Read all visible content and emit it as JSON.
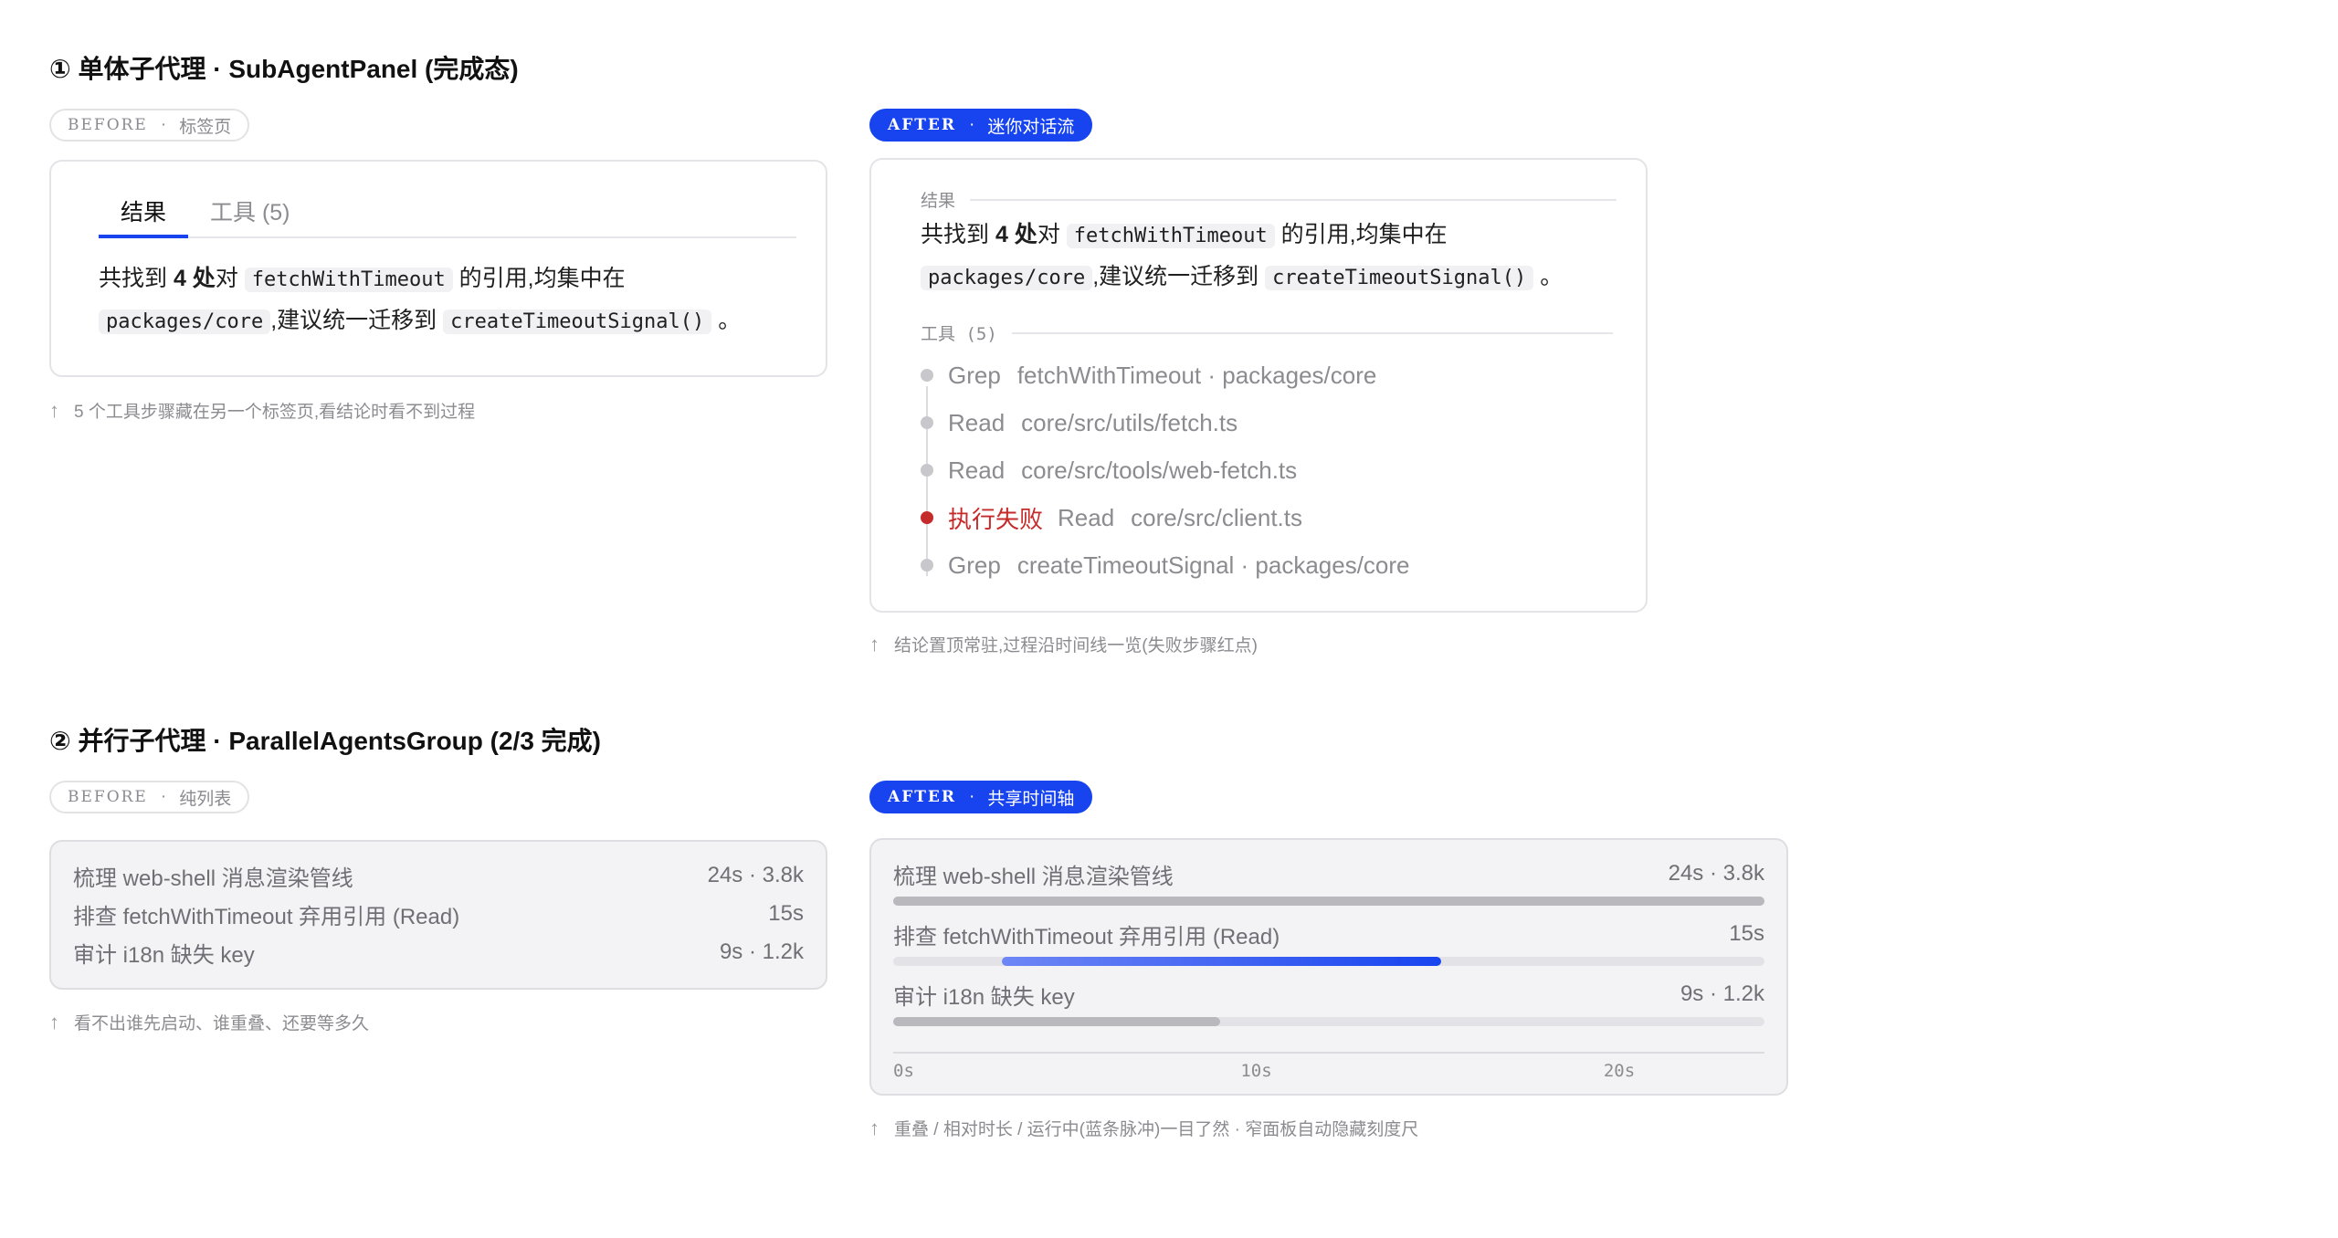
{
  "section1": {
    "title": "① 单体子代理 · SubAgentPanel (完成态)",
    "before": {
      "tag": "BEFORE",
      "sep": "·",
      "label": "标签页",
      "tabs": [
        {
          "label": "结果"
        },
        {
          "label": "工具 (5)"
        }
      ],
      "text": {
        "p1": "共找到 ",
        "count": "4 处",
        "p2": "对 ",
        "code1": "fetchWithTimeout",
        "p3": " 的引用,均集中在",
        "code2": "packages/core",
        "p4": ",建议统一迁移到 ",
        "code3": "createTimeoutSignal()",
        "p5": " 。"
      },
      "note": "5 个工具步骤藏在另一个标签页,看结论时看不到过程"
    },
    "after": {
      "tag": "AFTER",
      "sep": "·",
      "label": "迷你对话流",
      "result_head": "结果",
      "text": {
        "p1": "共找到 ",
        "count": "4 处",
        "p2": "对 ",
        "code1": "fetchWithTimeout",
        "p3": " 的引用,均集中在",
        "code2": "packages/core",
        "p4": ",建议统一迁移到 ",
        "code3": "createTimeoutSignal()",
        "p5": " 。"
      },
      "tools_head": "工具 (5)",
      "steps": [
        {
          "status": "done",
          "tool": "Grep",
          "target": "fetchWithTimeout · packages/core"
        },
        {
          "status": "done",
          "tool": "Read",
          "target": "core/src/utils/fetch.ts"
        },
        {
          "status": "done",
          "tool": "Read",
          "target": "core/src/tools/web-fetch.ts"
        },
        {
          "status": "failed",
          "fail_label": "执行失败",
          "tool": "Read",
          "target": "core/src/client.ts"
        },
        {
          "status": "done",
          "tool": "Grep",
          "target": "createTimeoutSignal · packages/core"
        }
      ],
      "note": "结论置顶常驻,过程沿时间线一览(失败步骤红点)"
    }
  },
  "section2": {
    "title": "② 并行子代理 · ParallelAgentsGroup (2/3 完成)",
    "before": {
      "tag": "BEFORE",
      "sep": "·",
      "label": "纯列表",
      "rows": [
        {
          "name": "梳理 web-shell 消息渲染管线",
          "meta": "24s · 3.8k"
        },
        {
          "name": "排查 fetchWithTimeout 弃用引用 (Read)",
          "meta": "15s"
        },
        {
          "name": "审计 i18n 缺失 key",
          "meta": "9s · 1.2k"
        }
      ],
      "note": "看不出谁先启动、谁重叠、还要等多久"
    },
    "after": {
      "tag": "AFTER",
      "sep": "·",
      "label": "共享时间轴",
      "axis_max": 24,
      "rows": [
        {
          "name": "梳理 web-shell 消息渲染管线",
          "meta": "24s · 3.8k",
          "start": 0,
          "end": 24,
          "running": false
        },
        {
          "name": "排查 fetchWithTimeout 弃用引用 (Read)",
          "meta": "15s",
          "start": 3,
          "end": 15.1,
          "running": true
        },
        {
          "name": "审计 i18n 缺失 key",
          "meta": "9s · 1.2k",
          "start": 0,
          "end": 9,
          "running": false
        }
      ],
      "ticks": [
        {
          "label": "0s",
          "value": 0
        },
        {
          "label": "10s",
          "value": 10
        },
        {
          "label": "20s",
          "value": 20
        }
      ],
      "note": "重叠 / 相对时长 / 运行中(蓝条脉冲)一目了然 · 窄面板自动隐藏刻度尺"
    }
  },
  "icons": {
    "note_arrow": "↑"
  },
  "colors": {
    "accent": "#1844f0",
    "fail": "#c62b2b",
    "muted": "#8b8b90"
  }
}
